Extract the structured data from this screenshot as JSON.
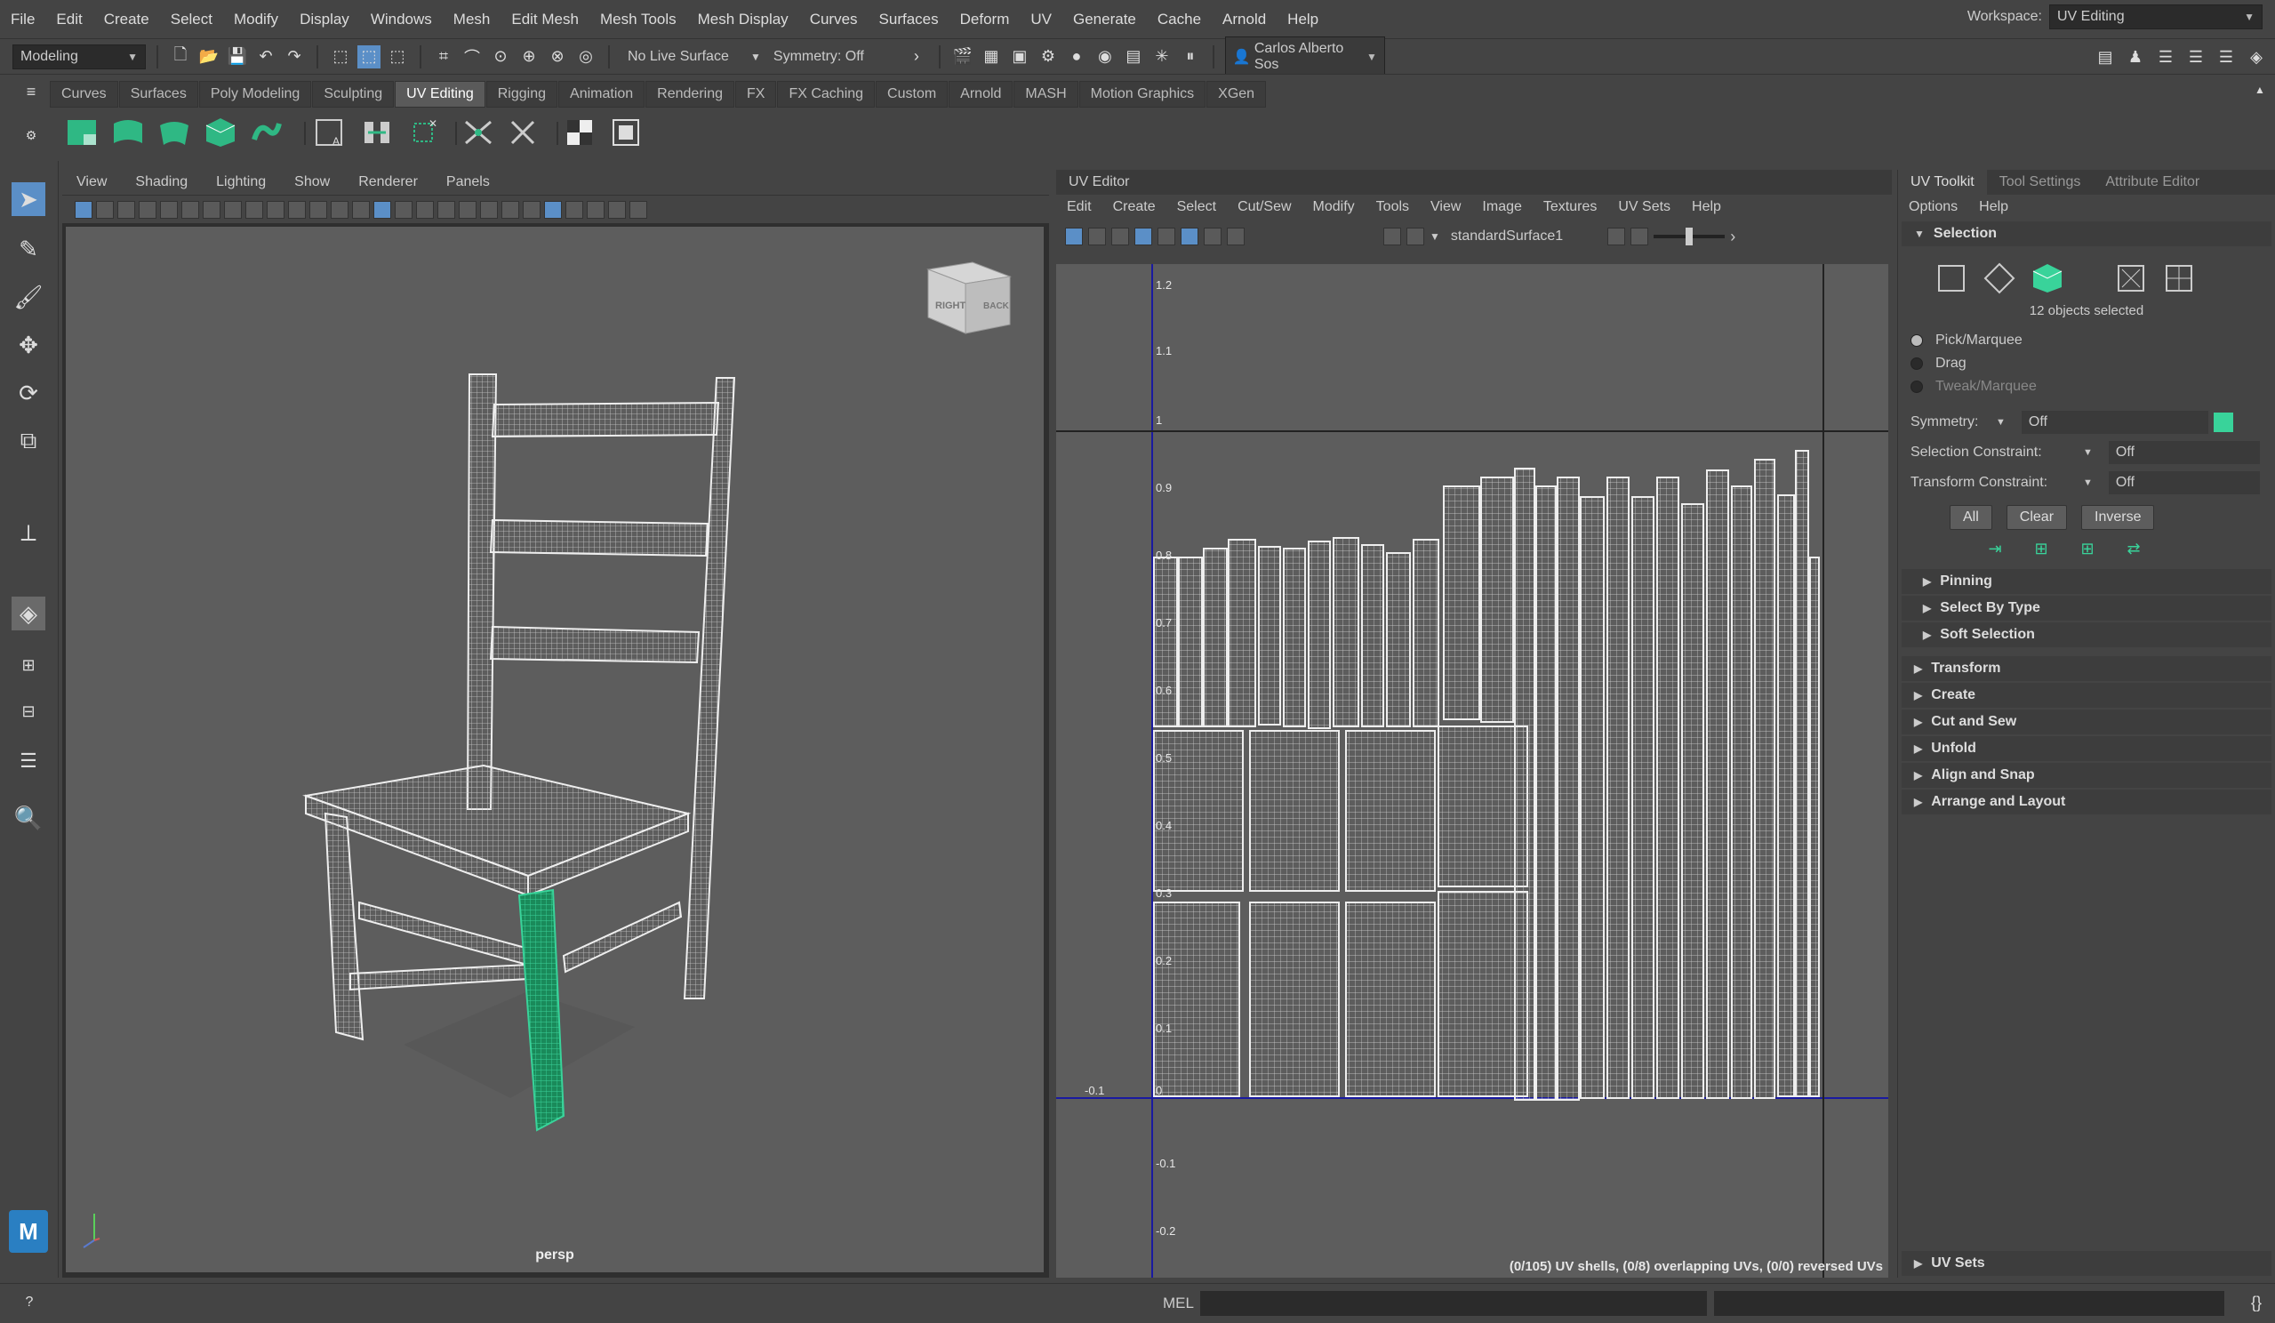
{
  "menubar": {
    "items": [
      "File",
      "Edit",
      "Create",
      "Select",
      "Modify",
      "Display",
      "Windows",
      "Mesh",
      "Edit Mesh",
      "Mesh Tools",
      "Mesh Display",
      "Curves",
      "Surfaces",
      "Deform",
      "UV",
      "Generate",
      "Cache",
      "Arnold",
      "Help"
    ],
    "workspace_label": "Workspace:",
    "workspace_value": "UV Editing"
  },
  "statusline": {
    "mode": "Modeling",
    "live_surface": "No Live Surface",
    "symmetry": "Symmetry: Off",
    "user": "Carlos Alberto Sos"
  },
  "shelf": {
    "tabs": [
      "Curves",
      "Surfaces",
      "Poly Modeling",
      "Sculpting",
      "UV Editing",
      "Rigging",
      "Animation",
      "Rendering",
      "FX",
      "FX Caching",
      "Custom",
      "Arnold",
      "MASH",
      "Motion Graphics",
      "XGen"
    ],
    "active_tab": "UV Editing"
  },
  "viewport": {
    "menu": [
      "View",
      "Shading",
      "Lighting",
      "Show",
      "Renderer",
      "Panels"
    ],
    "camera_label": "persp",
    "viewcube_right": "RIGHT",
    "viewcube_back": "BACK"
  },
  "uv_editor": {
    "title": "UV Editor",
    "menu": [
      "Edit",
      "Create",
      "Select",
      "Cut/Sew",
      "Modify",
      "Tools",
      "View",
      "Image",
      "Textures",
      "UV Sets",
      "Help"
    ],
    "shader": "standardSurface1",
    "y_ticks": [
      "1.2",
      "1.1",
      "1",
      "0.9",
      "0.8",
      "0.7",
      "0.6",
      "0.5",
      "0.4",
      "0.3",
      "0.2",
      "0.1",
      "0",
      "-0.1",
      "-0.2"
    ],
    "x_neg_label": "-0.1",
    "status": "(0/105) UV shells, (0/8) overlapping UVs, (0/0) reversed UVs"
  },
  "uv_toolkit": {
    "tabs": [
      "UV Toolkit",
      "Tool Settings",
      "Attribute Editor"
    ],
    "menu": [
      "Options",
      "Help"
    ],
    "selection_header": "Selection",
    "selected_count": "12 objects selected",
    "modes": [
      "Pick/Marquee",
      "Drag",
      "Tweak/Marquee"
    ],
    "symmetry_label": "Symmetry:",
    "symmetry_value": "Off",
    "sel_constraint_label": "Selection Constraint:",
    "sel_constraint_value": "Off",
    "xform_constraint_label": "Transform Constraint:",
    "xform_constraint_value": "Off",
    "buttons": [
      "All",
      "Clear",
      "Inverse"
    ],
    "subsections": [
      "Pinning",
      "Select By Type",
      "Soft Selection"
    ],
    "sections": [
      "Transform",
      "Create",
      "Cut and Sew",
      "Unfold",
      "Align and Snap",
      "Arrange and Layout"
    ],
    "uv_sets": "UV Sets"
  },
  "cmdline": {
    "lang": "MEL"
  },
  "colors": {
    "accent": "#5b8fc7",
    "selection": "#39d39a",
    "uv_bg": "#5d5d5d"
  }
}
